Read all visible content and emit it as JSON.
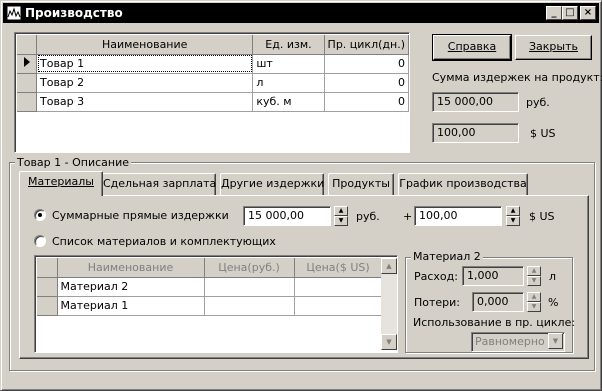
{
  "window": {
    "title": "Производство",
    "controls": [
      "_",
      "□",
      "×"
    ]
  },
  "products_grid": {
    "columns": [
      "Наименование",
      "Ед. изм.",
      "Пр. цикл(дн.)"
    ],
    "rows": [
      {
        "name": "Товар 1",
        "unit": "шт",
        "cycle": "0",
        "current": true
      },
      {
        "name": "Товар 2",
        "unit": "л",
        "cycle": "0",
        "current": false
      },
      {
        "name": "Товар 3",
        "unit": "куб. м",
        "cycle": "0",
        "current": false
      }
    ]
  },
  "buttons": {
    "help": "Справка",
    "close": "Закрыть"
  },
  "cost_summary": {
    "label": "Сумма издержек на продукт:",
    "rub_value": "15 000,00",
    "rub_unit": "руб.",
    "usd_value": "100,00",
    "usd_unit": "$ US"
  },
  "description_group": {
    "label": "Товар 1 - Описание"
  },
  "tabs": [
    {
      "label": "Материалы",
      "active": true
    },
    {
      "label": "Сдельная зарплата",
      "active": false
    },
    {
      "label": "Другие издержки",
      "active": false
    },
    {
      "label": "Продукты",
      "active": false
    },
    {
      "label": "График производства",
      "active": false
    }
  ],
  "materials_tab": {
    "option_direct": "Суммарные прямые издержки",
    "option_list": "Список материалов и комплектующих",
    "selected_option": "direct",
    "direct_rub_value": "15 000,00",
    "rub_unit": "руб.",
    "plus": "+",
    "direct_usd_value": "100,00",
    "usd_unit": "$ US",
    "materials_grid": {
      "columns": [
        "Наименование",
        "Цена(руб.)",
        "Цена($ US)"
      ],
      "rows": [
        {
          "name": "Материал 2",
          "price_rub": "",
          "price_usd": ""
        },
        {
          "name": "Материал 1",
          "price_rub": "",
          "price_usd": ""
        }
      ]
    },
    "material_group": {
      "label": "Материал 2",
      "consumption_label": "Расход:",
      "consumption_value": "1,000",
      "consumption_unit": "л",
      "loss_label": "Потери:",
      "loss_value": "0,000",
      "loss_unit": "%",
      "usage_label": "Использование в пр. цикле:",
      "usage_value": "Равномерно"
    }
  }
}
